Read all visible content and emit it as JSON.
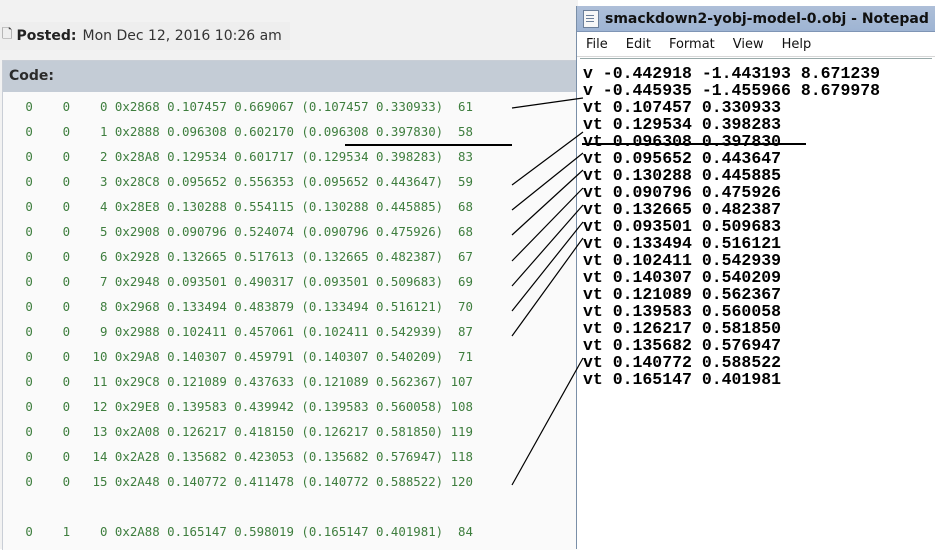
{
  "post": {
    "icon": "document-icon",
    "label": "Posted:",
    "date": "Mon Dec 12, 2016 10:26 am"
  },
  "code": {
    "label": "Code:",
    "rows": [
      "   0    0    0 0x2868 0.107457 0.669067 (0.107457 0.330933)  61",
      "   0    0    1 0x2888 0.096308 0.602170 (0.096308 0.397830)  58",
      "   0    0    2 0x28A8 0.129534 0.601717 (0.129534 0.398283)  83",
      "   0    0    3 0x28C8 0.095652 0.556353 (0.095652 0.443647)  59",
      "   0    0    4 0x28E8 0.130288 0.554115 (0.130288 0.445885)  68",
      "   0    0    5 0x2908 0.090796 0.524074 (0.090796 0.475926)  68",
      "   0    0    6 0x2928 0.132665 0.517613 (0.132665 0.482387)  67",
      "   0    0    7 0x2948 0.093501 0.490317 (0.093501 0.509683)  69",
      "   0    0    8 0x2968 0.133494 0.483879 (0.133494 0.516121)  70",
      "   0    0    9 0x2988 0.102411 0.457061 (0.102411 0.542939)  87",
      "   0    0   10 0x29A8 0.140307 0.459791 (0.140307 0.540209)  71",
      "   0    0   11 0x29C8 0.121089 0.437633 (0.121089 0.562367) 107",
      "   0    0   12 0x29E8 0.139583 0.439942 (0.139583 0.560058) 108",
      "   0    0   13 0x2A08 0.126217 0.418150 (0.126217 0.581850) 119",
      "   0    0   14 0x2A28 0.135682 0.423053 (0.135682 0.576947) 118",
      "   0    0   15 0x2A48 0.140772 0.411478 (0.140772 0.588522) 120",
      "   0    1    0 0x2A88 0.165147 0.598019 (0.165147 0.401981)  84"
    ]
  },
  "notepad": {
    "title": "smackdown2-yobj-model-0.obj - Notepad",
    "menu": [
      "File",
      "Edit",
      "Format",
      "View",
      "Help"
    ],
    "lines": [
      "v -0.442918 -1.443193 8.671239",
      "v -0.445935 -1.455966 8.679978",
      "vt 0.107457 0.330933",
      "vt 0.129534 0.398283",
      "vt 0.096308 0.397830",
      "vt 0.095652 0.443647",
      "vt 0.130288 0.445885",
      "vt 0.090796 0.475926",
      "vt 0.132665 0.482387",
      "vt 0.093501 0.509683",
      "vt 0.133494 0.516121",
      "vt 0.102411 0.542939",
      "vt 0.140307 0.540209",
      "vt 0.121089 0.562367",
      "vt 0.139583 0.560058",
      "vt 0.126217 0.581850",
      "vt 0.135682 0.576947",
      "vt 0.140772 0.588522",
      "vt 0.165147 0.401981"
    ]
  }
}
